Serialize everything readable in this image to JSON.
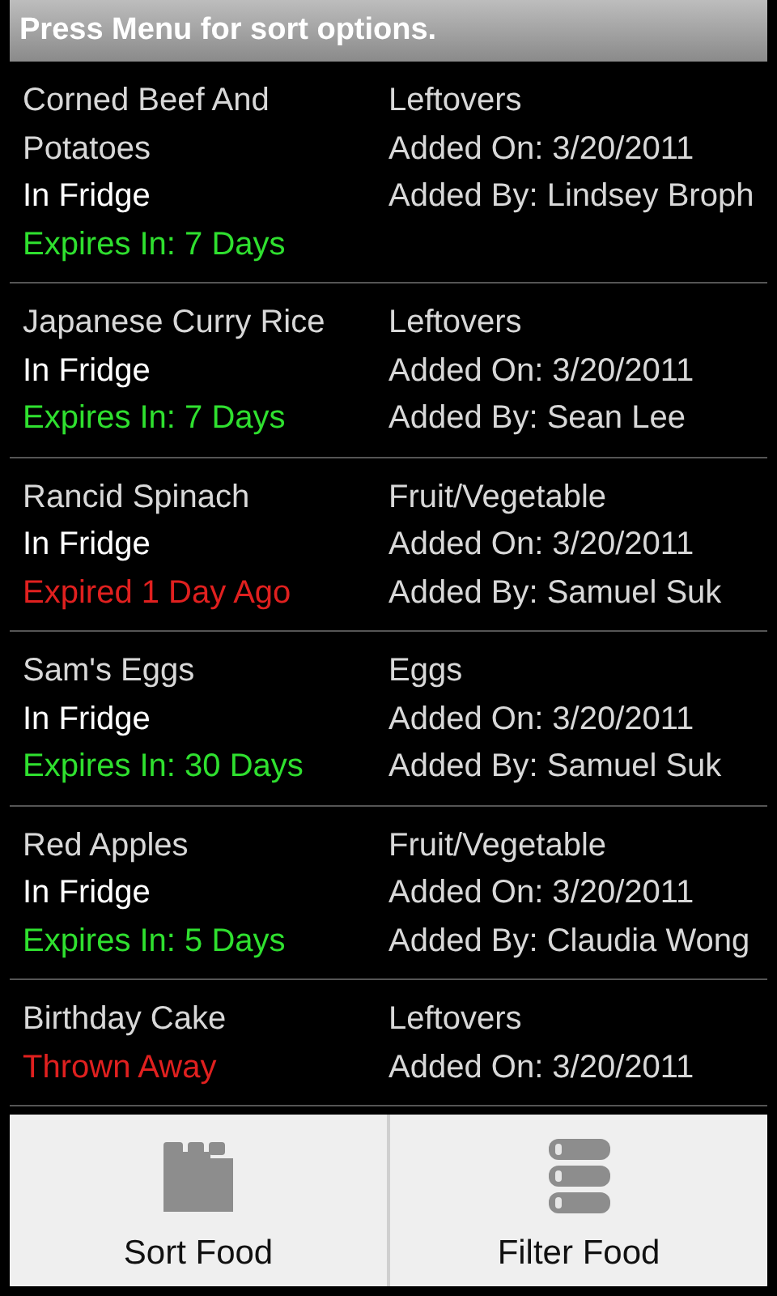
{
  "header": {
    "title": "Press Menu for sort options."
  },
  "foods": [
    {
      "name": "Corned Beef And Potatoes",
      "location": "In Fridge",
      "status": {
        "kind": "fresh",
        "text": "Expires In: 7 Days"
      },
      "category": "Leftovers",
      "added_on": "Added On: 3/20/2011",
      "added_by": "Added By: Lindsey Broph"
    },
    {
      "name": "Japanese Curry Rice",
      "location": "In Fridge",
      "status": {
        "kind": "fresh",
        "text": "Expires In: 7 Days"
      },
      "category": "Leftovers",
      "added_on": "Added On: 3/20/2011",
      "added_by": "Added By: Sean Lee"
    },
    {
      "name": "Rancid Spinach",
      "location": "In Fridge",
      "status": {
        "kind": "expired",
        "text": "Expired 1 Day Ago"
      },
      "category": "Fruit/Vegetable",
      "added_on": "Added On: 3/20/2011",
      "added_by": "Added By: Samuel Suk"
    },
    {
      "name": "Sam's Eggs",
      "location": "In Fridge",
      "status": {
        "kind": "fresh",
        "text": "Expires In: 30 Days"
      },
      "category": "Eggs",
      "added_on": "Added On: 3/20/2011",
      "added_by": "Added By: Samuel Suk"
    },
    {
      "name": "Red Apples",
      "location": "In Fridge",
      "status": {
        "kind": "fresh",
        "text": "Expires In: 5 Days"
      },
      "category": "Fruit/Vegetable",
      "added_on": "Added On: 3/20/2011",
      "added_by": "Added By: Claudia Wong"
    },
    {
      "name": "Birthday Cake",
      "status": {
        "kind": "thrown",
        "text": "Thrown Away"
      },
      "category": "Leftovers",
      "added_on": "Added On: 3/20/2011"
    }
  ],
  "menu": [
    {
      "kind": "sort",
      "label": "Sort Food"
    },
    {
      "kind": "filter",
      "label": "Filter Food"
    }
  ]
}
